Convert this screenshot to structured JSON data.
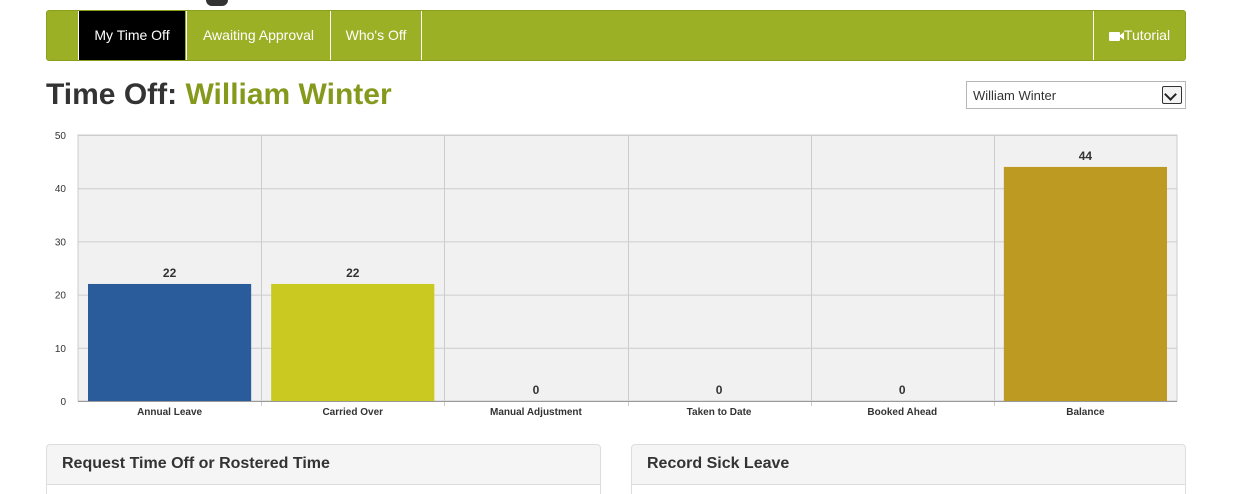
{
  "nav": {
    "tabs": [
      {
        "label": "My Time Off",
        "active": true
      },
      {
        "label": "Awaiting Approval",
        "active": false
      },
      {
        "label": "Who's Off",
        "active": false
      }
    ],
    "tutorial": {
      "label": "Tutorial",
      "icon": "video-camera-icon"
    }
  },
  "title": {
    "prefix": "Time Off:",
    "name": "William Winter"
  },
  "user_select": {
    "selected": "William Winter"
  },
  "colors": {
    "nav_bg": "#9bb025",
    "active_tab": "#000000",
    "name_accent": "#85991c"
  },
  "chart_data": {
    "type": "bar",
    "categories": [
      "Annual Leave",
      "Carried Over",
      "Manual Adjustment",
      "Taken to Date",
      "Booked Ahead",
      "Balance"
    ],
    "values": [
      22,
      22,
      0,
      0,
      0,
      44
    ],
    "colors": [
      "#2a5c9c",
      "#c9c921",
      "#c9c921",
      "#c9c921",
      "#c9c921",
      "#bd9a22"
    ],
    "data_labels": [
      "22",
      "22",
      "0",
      "0",
      "0",
      "44"
    ],
    "ylim": [
      0,
      50
    ],
    "yticks": [
      0,
      10,
      20,
      30,
      40,
      50
    ],
    "grid": true
  },
  "panels": {
    "request": {
      "title": "Request Time Off or Rostered Time"
    },
    "sick": {
      "title": "Record Sick Leave"
    }
  }
}
